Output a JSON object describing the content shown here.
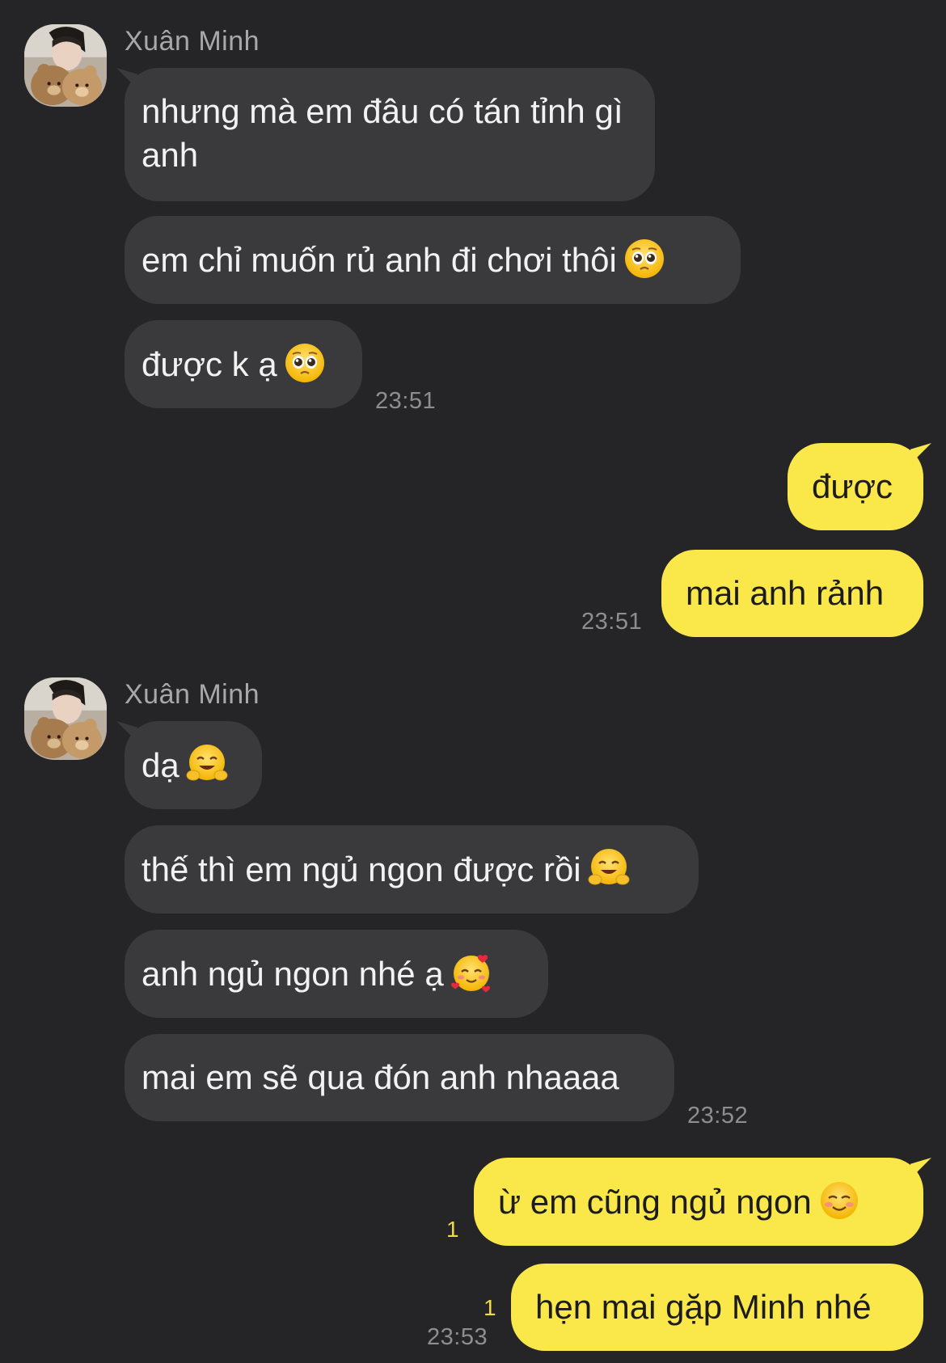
{
  "contact": {
    "name": "Xuân Minh"
  },
  "groups": [
    {
      "sender_name": "Xuân Minh",
      "messages": [
        "nhưng mà em đâu có tán tỉnh gì anh",
        "em chỉ muốn rủ anh đi chơi thôi",
        "được k ạ"
      ],
      "time": "23:51"
    },
    {
      "messages": [
        "được",
        "mai anh rảnh"
      ],
      "time": "23:51"
    },
    {
      "sender_name": "Xuân Minh",
      "messages": [
        "dạ",
        "thế thì em ngủ ngon được rồi",
        "anh ngủ ngon nhé ạ",
        "mai em sẽ qua đón anh nhaaaa"
      ],
      "time": "23:52"
    },
    {
      "messages": [
        "ừ em cũng ngủ ngon",
        "hẹn mai gặp Minh nhé"
      ],
      "unread_counts": [
        "1",
        "1"
      ],
      "time": "23:53"
    }
  ],
  "emoji_icons": {
    "pleading": "pleading-face-icon",
    "hugging": "hugging-face-icon",
    "hearts": "smiling-face-with-hearts-icon",
    "smiling": "smiling-face-icon"
  },
  "colors": {
    "background": "#252527",
    "incoming_bubble": "#3a3a3c",
    "outgoing_bubble": "#fae84a",
    "incoming_text": "#f2f2f2",
    "outgoing_text": "#1c1c1c",
    "timestamp": "#8e8e90",
    "unread": "#f0dc3c"
  }
}
